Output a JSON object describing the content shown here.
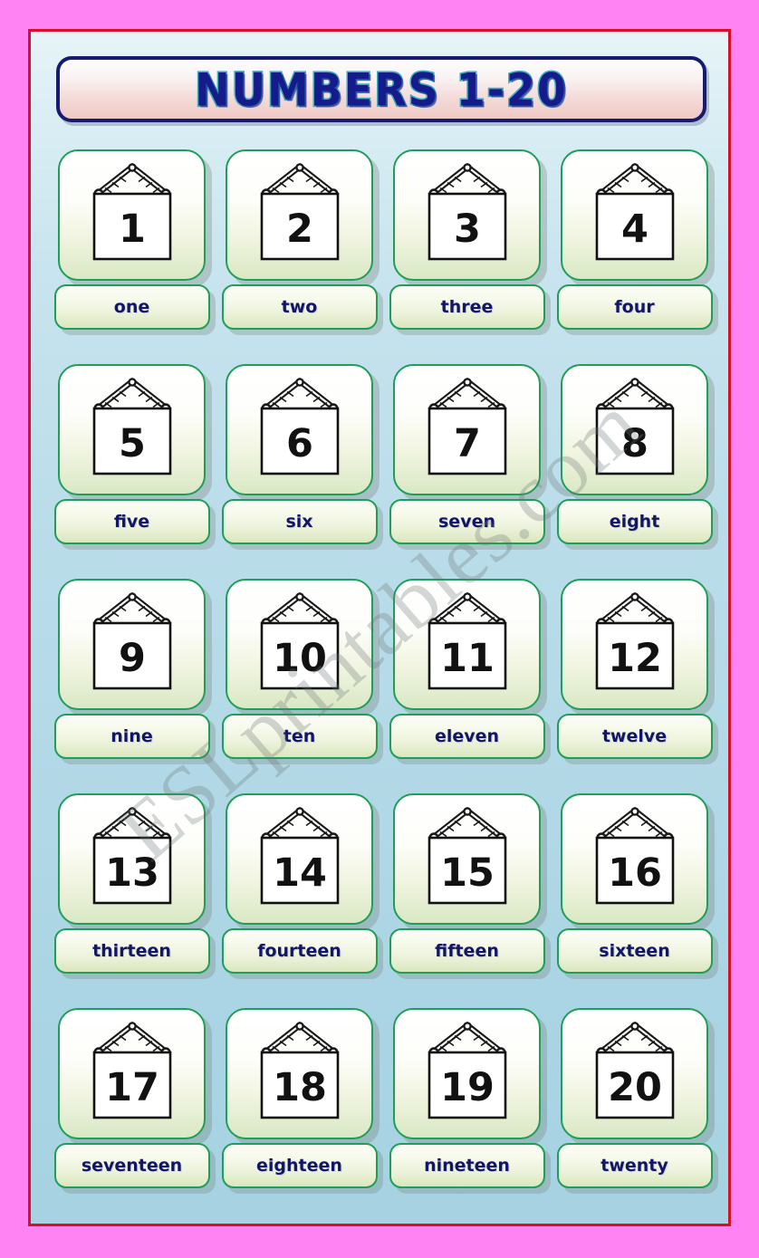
{
  "theme": {
    "outer_frame_color": "#FF83F3",
    "panel_border_color": "#D61028",
    "panel_bg_top": "#E7F4F7",
    "panel_bg_bottom": "#A6D2E2",
    "card_border_color": "#1E9E56",
    "title_text_color": "#151B8B",
    "title_outline_color": "#3EAEBE",
    "label_text_color": "#131668",
    "banner_border_color": "#151B6E"
  },
  "title": {
    "text": "NUMBERS 1-20"
  },
  "watermark": {
    "text": "ESLprintables.com"
  },
  "grid": {
    "columns": 4,
    "rows": 5,
    "cards": [
      {
        "number": "1",
        "word": "one",
        "icon": "hanging-sign-icon"
      },
      {
        "number": "2",
        "word": "two",
        "icon": "hanging-sign-icon"
      },
      {
        "number": "3",
        "word": "three",
        "icon": "hanging-sign-icon"
      },
      {
        "number": "4",
        "word": "four",
        "icon": "hanging-sign-icon"
      },
      {
        "number": "5",
        "word": "five",
        "icon": "hanging-sign-icon"
      },
      {
        "number": "6",
        "word": "six",
        "icon": "hanging-sign-icon"
      },
      {
        "number": "7",
        "word": "seven",
        "icon": "hanging-sign-icon"
      },
      {
        "number": "8",
        "word": "eight",
        "icon": "hanging-sign-icon"
      },
      {
        "number": "9",
        "word": "nine",
        "icon": "hanging-sign-icon"
      },
      {
        "number": "10",
        "word": "ten",
        "icon": "hanging-sign-icon"
      },
      {
        "number": "11",
        "word": "eleven",
        "icon": "hanging-sign-icon"
      },
      {
        "number": "12",
        "word": "twelve",
        "icon": "hanging-sign-icon"
      },
      {
        "number": "13",
        "word": "thirteen",
        "icon": "hanging-sign-icon"
      },
      {
        "number": "14",
        "word": "fourteen",
        "icon": "hanging-sign-icon"
      },
      {
        "number": "15",
        "word": "fifteen",
        "icon": "hanging-sign-icon"
      },
      {
        "number": "16",
        "word": "sixteen",
        "icon": "hanging-sign-icon"
      },
      {
        "number": "17",
        "word": "seventeen",
        "icon": "hanging-sign-icon"
      },
      {
        "number": "18",
        "word": "eighteen",
        "icon": "hanging-sign-icon"
      },
      {
        "number": "19",
        "word": "nineteen",
        "icon": "hanging-sign-icon"
      },
      {
        "number": "20",
        "word": "twenty",
        "icon": "hanging-sign-icon"
      }
    ]
  }
}
